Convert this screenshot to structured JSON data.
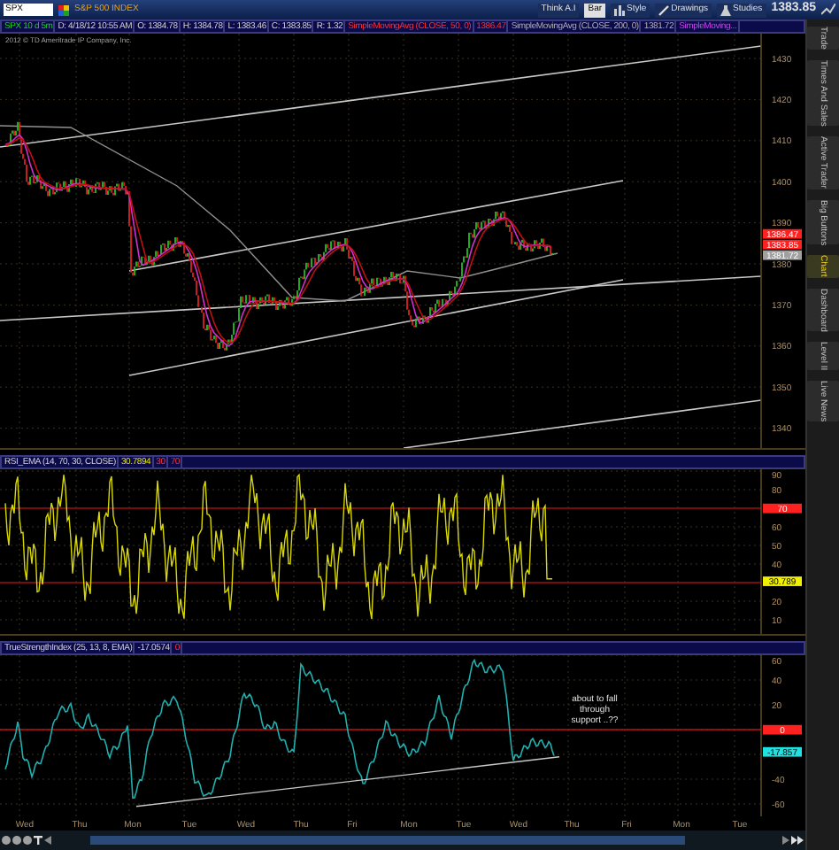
{
  "toolbar": {
    "symbol": "SPX",
    "description": "S&P 500 INDEX",
    "buttons": [
      {
        "label": "Think A.I",
        "kind": "plain",
        "selected": false
      },
      {
        "label": "Bar",
        "kind": "plain",
        "selected": true
      },
      {
        "label": "Style",
        "kind": "style",
        "selected": false
      },
      {
        "label": "Drawings",
        "kind": "drawings",
        "selected": false
      },
      {
        "label": "Studies",
        "kind": "studies",
        "selected": false
      }
    ],
    "last_price": "1383.85"
  },
  "price_panel": {
    "header": [
      {
        "text": "SPX 10 d 5m",
        "kind": "symbol"
      },
      {
        "text": "D: 4/18/12 10:55 AM",
        "kind": "plain"
      },
      {
        "text": "O: 1384.78",
        "kind": "plain"
      },
      {
        "text": "H: 1384.78",
        "kind": "plain"
      },
      {
        "text": "L: 1383.46",
        "kind": "plain"
      },
      {
        "text": "C: 1383.85",
        "kind": "plain"
      },
      {
        "text": "R: 1.32",
        "kind": "plain"
      },
      {
        "text": "SimpleMovingAvg (CLOSE, 50, 0)",
        "kind": "red"
      },
      {
        "text": "1386.47",
        "kind": "red"
      },
      {
        "text": "SimpleMovingAvg (CLOSE, 200, 0)",
        "kind": "grey"
      },
      {
        "text": "1381.72",
        "kind": "grey"
      },
      {
        "text": "SimpleMoving...",
        "kind": "purple"
      }
    ],
    "copyright": "2012 © TD Ameritrade IP Company, Inc.",
    "axis_labels": [
      "1430",
      "1420",
      "1410",
      "1400",
      "1390",
      "1380",
      "1370",
      "1360",
      "1350",
      "1340"
    ],
    "markers": [
      {
        "text": "1386.47",
        "color": "#ff2020"
      },
      {
        "text": "1383.85",
        "color": "#ff2020"
      },
      {
        "text": "1381.72",
        "color": "#a0a0a0"
      }
    ]
  },
  "rsi_panel": {
    "header": [
      {
        "text": "RSI_EMA (14, 70, 30, CLOSE)",
        "kind": "plain"
      },
      {
        "text": "30.7894",
        "kind": "yellow"
      },
      {
        "text": "30",
        "kind": "red"
      },
      {
        "text": "70",
        "kind": "red"
      }
    ],
    "axis_labels": [
      "90",
      "80",
      "60",
      "50",
      "40",
      "20",
      "10"
    ],
    "markers": [
      {
        "text": "70",
        "color": "#ff2020"
      },
      {
        "text": "30.789",
        "color": "#f0f000"
      }
    ]
  },
  "tsi_panel": {
    "header": [
      {
        "text": "TrueStrengthIndex (25, 13, 8, EMA)",
        "kind": "plain"
      },
      {
        "text": "-17.0574",
        "kind": "plain"
      },
      {
        "text": "0",
        "kind": "red"
      }
    ],
    "axis_labels": [
      "60",
      "40",
      "20",
      "-40",
      "-60"
    ],
    "markers": [
      {
        "text": "0",
        "color": "#ff2020"
      },
      {
        "text": "-17.857",
        "color": "#20e0e0"
      }
    ],
    "annotation": "about to fall through support ..??"
  },
  "time_axis": [
    "Wed",
    "Thu",
    "Mon",
    "Tue",
    "Wed",
    "Thu",
    "Fri",
    "Mon",
    "Tue",
    "Wed",
    "Thu",
    "Fri",
    "Mon",
    "Tue"
  ],
  "sidebar": {
    "tabs": [
      {
        "label": "Trade",
        "selected": false
      },
      {
        "label": "Times And Sales",
        "selected": false
      },
      {
        "label": "Active Trader",
        "selected": false
      },
      {
        "label": "Big Buttons",
        "selected": false
      },
      {
        "label": "Chart",
        "selected": true
      },
      {
        "label": "Dashboard",
        "selected": false
      },
      {
        "label": "Level II",
        "selected": false
      },
      {
        "label": "Live News",
        "selected": false
      }
    ]
  }
}
